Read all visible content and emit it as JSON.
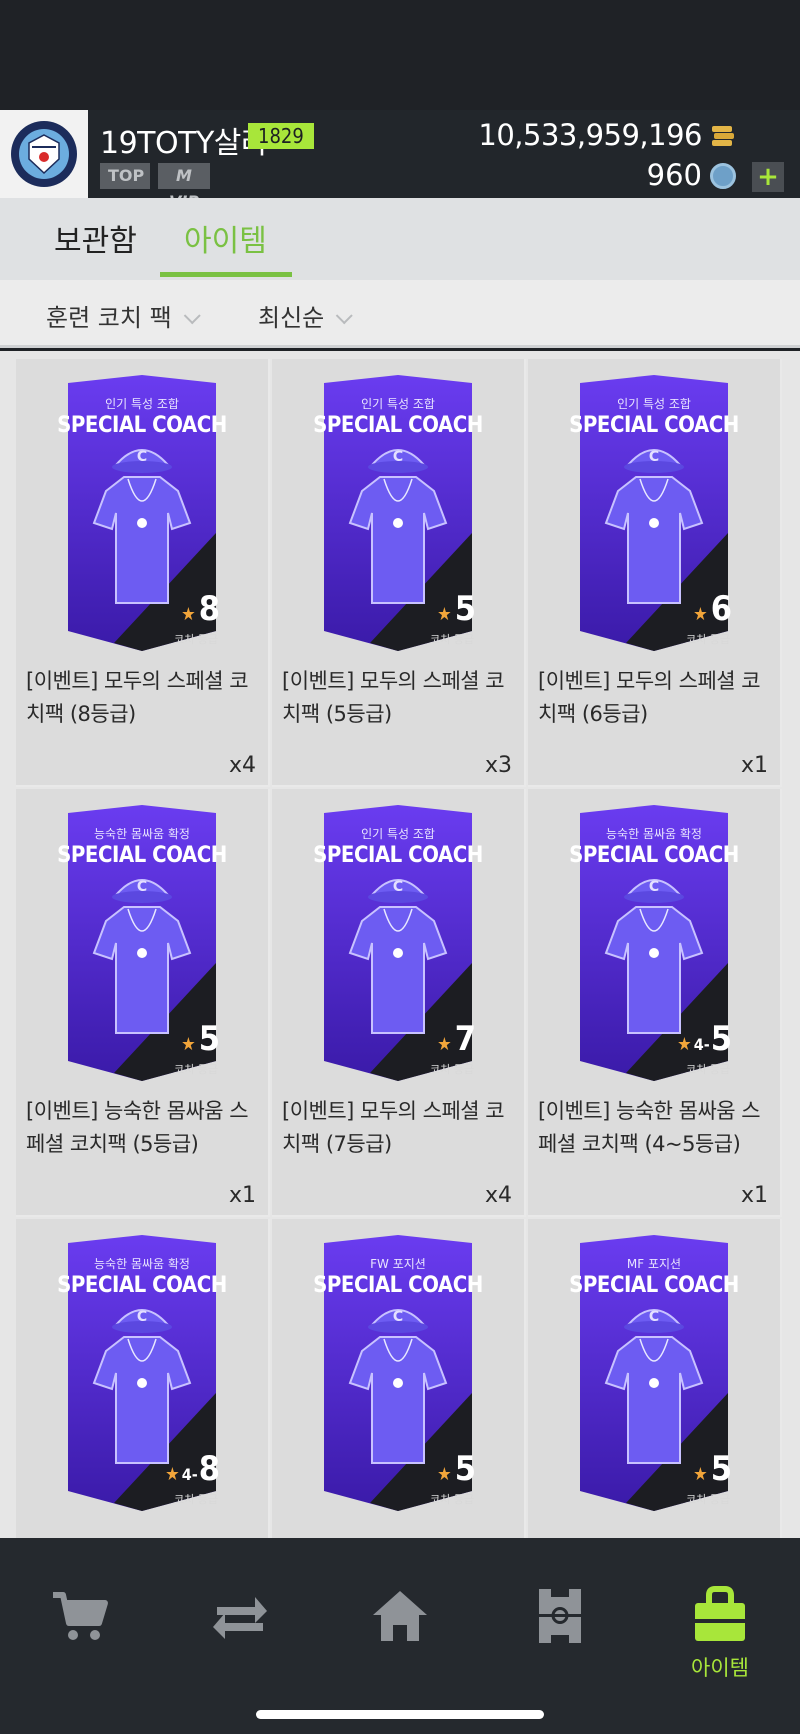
{
  "header": {
    "nickname": "19TOTY살라",
    "level": "1829",
    "tag_top": "TOP",
    "tag_vip": "M VIP",
    "coins": "10,533,959,196",
    "gems": "960",
    "plus": "+"
  },
  "tabs": [
    {
      "label": "보관함",
      "active": false
    },
    {
      "label": "아이템",
      "active": true
    }
  ],
  "filters": {
    "type": "훈련 코치 팩",
    "sort": "최신순"
  },
  "items": [
    {
      "subtitle": "인기 특성 조합",
      "title": "SPECIAL COACH",
      "grade": "8",
      "range": "",
      "grade_label": "코치 등급",
      "name": "[이벤트] 모두의 스페셜 코치팩 (8등급)",
      "qty": "x4"
    },
    {
      "subtitle": "인기 특성 조합",
      "title": "SPECIAL COACH",
      "grade": "5",
      "range": "",
      "grade_label": "코치 등급",
      "name": "[이벤트] 모두의 스페셜 코치팩 (5등급)",
      "qty": "x3"
    },
    {
      "subtitle": "인기 특성 조합",
      "title": "SPECIAL COACH",
      "grade": "6",
      "range": "",
      "grade_label": "코치 등급",
      "name": "[이벤트] 모두의 스페셜 코치팩 (6등급)",
      "qty": "x1"
    },
    {
      "subtitle": "능숙한 몸싸움 확정",
      "title": "SPECIAL COACH",
      "grade": "5",
      "range": "",
      "grade_label": "코치 등급",
      "name": "[이벤트] 능숙한 몸싸움 스페셜 코치팩 (5등급)",
      "qty": "x1"
    },
    {
      "subtitle": "인기 특성 조합",
      "title": "SPECIAL COACH",
      "grade": "7",
      "range": "",
      "grade_label": "코치 등급",
      "name": "[이벤트] 모두의 스페셜 코치팩 (7등급)",
      "qty": "x4"
    },
    {
      "subtitle": "능숙한 몸싸움 확정",
      "title": "SPECIAL COACH",
      "grade": "5",
      "range": "4-",
      "grade_label": "코치 등급",
      "name": "[이벤트] 능숙한 몸싸움 스페셜 코치팩 (4~5등급)",
      "qty": "x1"
    },
    {
      "subtitle": "능숙한 몸싸움 확정",
      "title": "SPECIAL COACH",
      "grade": "8",
      "range": "4-",
      "grade_label": "코치 등급",
      "name": "",
      "qty": ""
    },
    {
      "subtitle": "FW 포지션",
      "title": "SPECIAL COACH",
      "grade": "5",
      "range": "",
      "grade_label": "코치 등급",
      "name": "",
      "qty": ""
    },
    {
      "subtitle": "MF 포지션",
      "title": "SPECIAL COACH",
      "grade": "5",
      "range": "",
      "grade_label": "코치 등급",
      "name": "",
      "qty": ""
    }
  ],
  "nav": {
    "active_label": "아이템"
  },
  "colors": {
    "accent": "#a8e63a",
    "tab_active": "#7ac143",
    "pack_purple": "#5a2ee0",
    "header_bg": "#22262b"
  }
}
